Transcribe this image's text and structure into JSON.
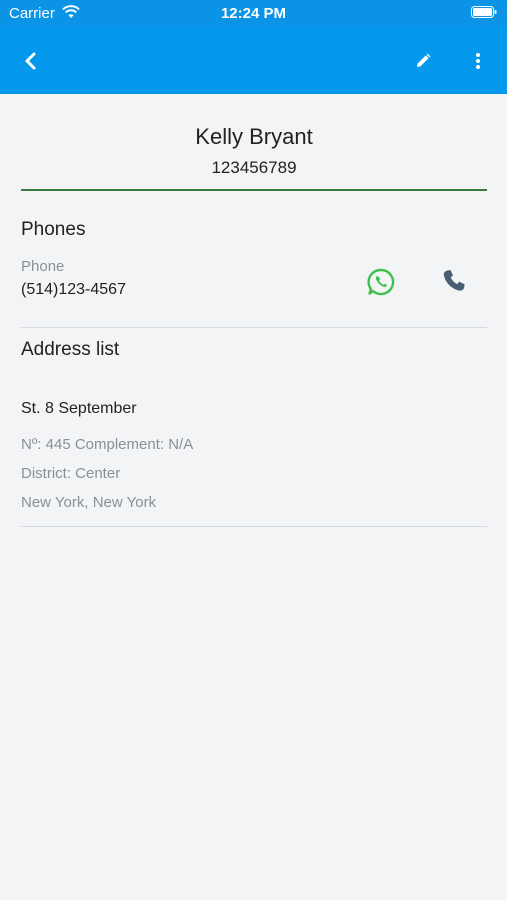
{
  "status_bar": {
    "carrier": "Carrier",
    "time": "12:24 PM"
  },
  "nav": {
    "icons": [
      "chevron-left-icon",
      "pencil-icon",
      "more-vertical-icon"
    ],
    "background": "#0599ee"
  },
  "contact": {
    "name": "Kelly Bryant",
    "document": "123456789"
  },
  "phones": {
    "title": "Phones",
    "items": [
      {
        "label": "Phone",
        "number": "(514)123-4567"
      }
    ]
  },
  "address": {
    "title": "Address list",
    "street": "St. 8 September",
    "number_line": "Nº: 445  Complement: N/A",
    "district_line": "District: Center",
    "city_line": "New York, New York"
  },
  "colors": {
    "accent": "#0599ee",
    "whatsapp": "#3cc14b",
    "call": "#4a5d72",
    "divider_green": "#3a7d3a"
  }
}
